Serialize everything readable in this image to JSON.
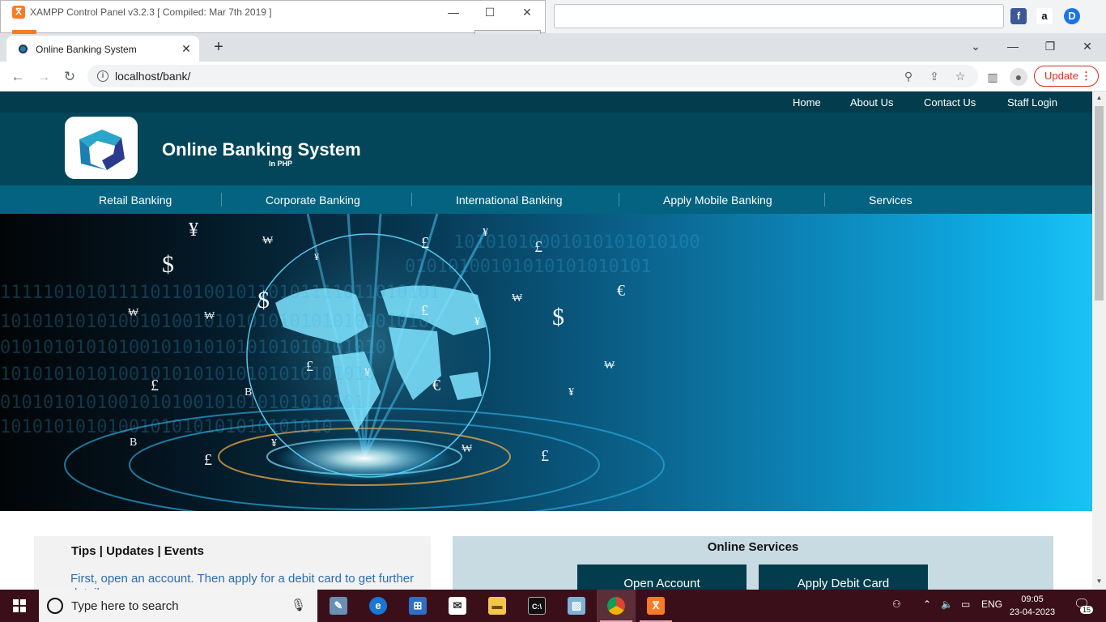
{
  "xampp": {
    "title": "XAMPP Control Panel v3.2.3   [ Compiled: Mar 7th 2019 ]",
    "minimize": "—",
    "maximize": "☐",
    "close": "✕"
  },
  "browser": {
    "tab_title": "Online Banking System",
    "tab_close": "✕",
    "new_tab": "+",
    "url": "localhost/bank/",
    "update_label": "Update",
    "window": {
      "dropdown": "⌄",
      "minimize": "—",
      "restore": "❐",
      "close": "✕"
    }
  },
  "site": {
    "topnav": [
      "Home",
      "About Us",
      "Contact Us",
      "Staff Login"
    ],
    "brand": "Online Banking System",
    "brand_sub": "In PHP",
    "mainnav": [
      "Retail Banking",
      "Corporate Banking",
      "International Banking",
      "Apply Mobile Banking",
      "Services"
    ],
    "tips_title": "Tips | Updates | Events",
    "tips_text": "First, open an account. Then apply for a debit card to get further details",
    "services_title": "Online Services",
    "services_buttons": [
      "Open Account",
      "Apply Debit Card"
    ]
  },
  "taskbar": {
    "search_placeholder": "Type here to search",
    "language": "ENG",
    "time": "09:05",
    "date": "23-04-2023",
    "notifications": "15"
  },
  "colors": {
    "topnav_bg": "#033d4d",
    "header_bg": "#03465a",
    "mainnav_bg": "#046380",
    "button_bg": "#033d4d",
    "services_bg": "#c8dbe3",
    "tips_link": "#2c6cb0",
    "taskbar_bg": "#3b0f1a",
    "update_red": "#d93025"
  }
}
